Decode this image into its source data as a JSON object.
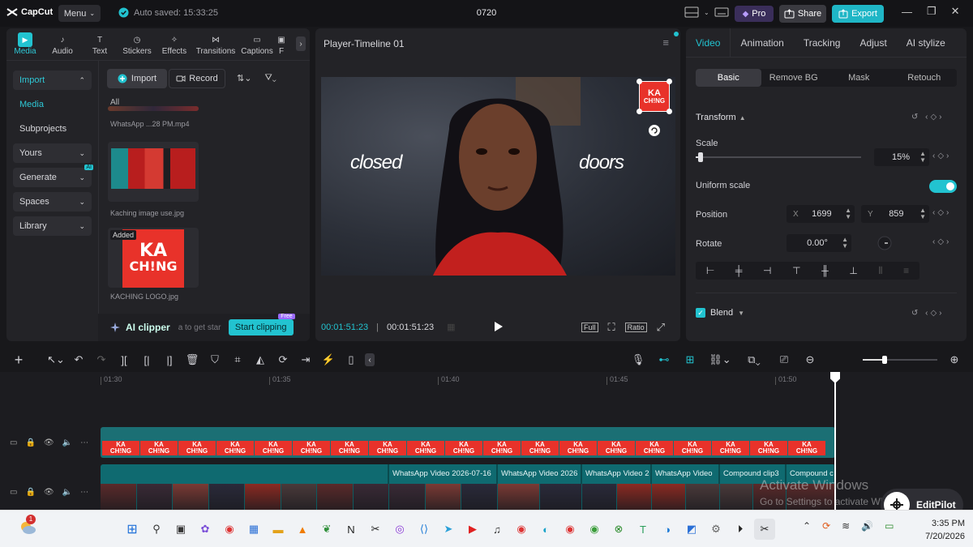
{
  "titlebar": {
    "app_name": "CapCut",
    "menu_label": "Menu",
    "autosave": "Auto saved: 15:33:25",
    "project_name": "0720",
    "pro_label": "Pro",
    "share_label": "Share",
    "export_label": "Export"
  },
  "media_tabs": [
    {
      "label": "Media",
      "icon": "media-icon"
    },
    {
      "label": "Audio",
      "icon": "audio-icon"
    },
    {
      "label": "Text",
      "icon": "text-icon"
    },
    {
      "label": "Stickers",
      "icon": "stickers-icon"
    },
    {
      "label": "Effects",
      "icon": "effects-icon"
    },
    {
      "label": "Transitions",
      "icon": "transitions-icon"
    },
    {
      "label": "Captions",
      "icon": "captions-icon"
    },
    {
      "label": "F",
      "icon": "filters-icon"
    }
  ],
  "sidebar": {
    "import": "Import",
    "media": "Media",
    "subprojects": "Subprojects",
    "yours": "Yours",
    "generate": "Generate",
    "generate_badge": "AI",
    "spaces": "Spaces",
    "library": "Library"
  },
  "media_toolbar": {
    "import_btn": "Import",
    "record_btn": "Record",
    "filter_all": "All"
  },
  "media_items": [
    {
      "caption": "WhatsApp ...28 PM.mp4"
    },
    {
      "caption": "Kaching image use.jpg"
    },
    {
      "caption": "KACHING LOGO.jpg",
      "badge": "Added",
      "logo_top": "KA",
      "logo_bottom": "CH!NG"
    }
  ],
  "ai_clipper": {
    "label": "AI clipper",
    "hint": "a to get star",
    "start_btn": "Start clipping",
    "badge": "Free"
  },
  "player": {
    "title": "Player-Timeline 01",
    "overlay_left": "closed",
    "overlay_right": "doors",
    "sticker_top": "KA",
    "sticker_bottom": "CH!NG",
    "current_time": "00:01:51:23",
    "total_time": "00:01:51:23",
    "full_label": "Full",
    "ratio_label": "Ratio"
  },
  "inspector": {
    "tabs": [
      "Video",
      "Animation",
      "Tracking",
      "Adjust",
      "AI stylize"
    ],
    "subtabs": [
      "Basic",
      "Remove BG",
      "Mask",
      "Retouch"
    ],
    "transform": "Transform",
    "scale_label": "Scale",
    "scale_value": "15%",
    "scale_level": 0.15,
    "uniform_label": "Uniform scale",
    "uniform_on": true,
    "position_label": "Position",
    "pos_x_label": "X",
    "pos_x": "1699",
    "pos_y_label": "Y",
    "pos_y": "859",
    "rotate_label": "Rotate",
    "rotate_value": "0.00°",
    "blend_label": "Blend",
    "accent": "#22c3d0"
  },
  "timeline": {
    "ruler": [
      "01:30",
      "01:35",
      "01:40",
      "01:45",
      "01:50"
    ],
    "clips": [
      {
        "label": ""
      },
      {
        "label": "WhatsApp Video 2026-07-16"
      },
      {
        "label": "WhatsApp Video 2026"
      },
      {
        "label": "WhatsApp Video 2"
      },
      {
        "label": "WhatsApp Video"
      },
      {
        "label": "Compound clip3"
      },
      {
        "label": "Compound c"
      }
    ],
    "sticker_text": "KA\nCH!NG"
  },
  "watermark": {
    "line1": "Activate Windows",
    "line2": "Go to Settings to activate Windows."
  },
  "editpilot": {
    "label": "EditPilot"
  },
  "taskbar": {
    "notif_count": "1",
    "time": "3:35 PM",
    "date": "7/20/2026"
  }
}
